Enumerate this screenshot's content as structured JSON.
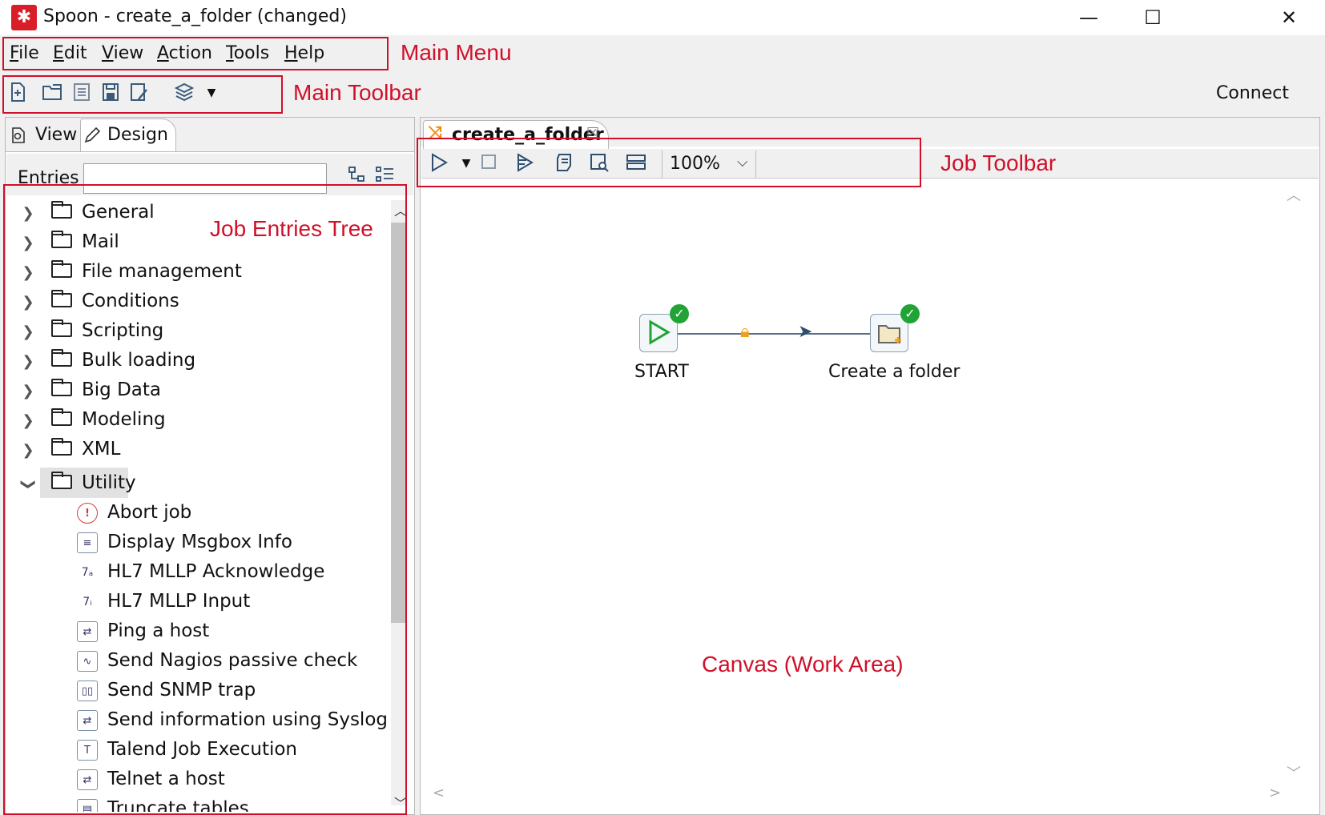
{
  "window": {
    "title": "Spoon - create_a_folder (changed)",
    "controls": {
      "minimize": "—",
      "maximize": "☐",
      "close": "✕"
    }
  },
  "menu": {
    "items": [
      "File",
      "Edit",
      "View",
      "Action",
      "Tools",
      "Help"
    ]
  },
  "toolbar": {
    "icons": [
      "new-file-icon",
      "open-file-icon",
      "explore-repository-icon",
      "save-icon",
      "save-as-icon",
      "perspective-layers-icon",
      "dropdown-arrow-icon"
    ],
    "connect_label": "Connect"
  },
  "left_panel": {
    "tabs": {
      "view": "View",
      "design": "Design"
    },
    "entries_label": "Entries",
    "entries_input_value": "",
    "folders": [
      "General",
      "Mail",
      "File management",
      "Conditions",
      "Scripting",
      "Bulk loading",
      "Big Data",
      "Modeling",
      "XML",
      "Utility"
    ],
    "expanded_folder": "Utility",
    "utility_entries": [
      {
        "label": "Abort job",
        "icon": "abort-icon"
      },
      {
        "label": "Display Msgbox Info",
        "icon": "msgbox-icon"
      },
      {
        "label": "HL7 MLLP Acknowledge",
        "icon": "hl7-ack-icon"
      },
      {
        "label": "HL7 MLLP Input",
        "icon": "hl7-input-icon"
      },
      {
        "label": "Ping a host",
        "icon": "ping-icon"
      },
      {
        "label": "Send Nagios passive check",
        "icon": "nagios-icon"
      },
      {
        "label": "Send SNMP trap",
        "icon": "snmp-icon"
      },
      {
        "label": "Send information using Syslog",
        "icon": "syslog-icon"
      },
      {
        "label": "Talend Job Execution",
        "icon": "talend-icon"
      },
      {
        "label": "Telnet a host",
        "icon": "telnet-icon"
      },
      {
        "label": "Truncate tables",
        "icon": "truncate-icon"
      }
    ]
  },
  "job_tab": {
    "label": "create_a_folder",
    "close": "☒"
  },
  "job_toolbar": {
    "zoom": "100%",
    "icons": [
      "run-icon",
      "run-dropdown-icon",
      "stop-icon",
      "replay-icon",
      "check-job-icon",
      "sql-icon",
      "explore-db-icon"
    ]
  },
  "canvas": {
    "nodes": [
      {
        "label": "START",
        "status": "success",
        "icon": "start-icon"
      },
      {
        "label": "Create a folder",
        "status": "success",
        "icon": "create-folder-icon"
      }
    ],
    "hop_icons": [
      "lock-icon",
      "arrow-icon"
    ]
  },
  "annotations": {
    "main_menu": "Main Menu",
    "main_toolbar": "Main Toolbar",
    "job_toolbar": "Job Toolbar",
    "job_entries_tree": "Job Entries Tree",
    "canvas": "Canvas (Work Area)"
  },
  "colors": {
    "annotation": "#d0102a",
    "success": "#21a336",
    "brand": "#d81e28",
    "job_tab_icon": "#f08a00"
  }
}
